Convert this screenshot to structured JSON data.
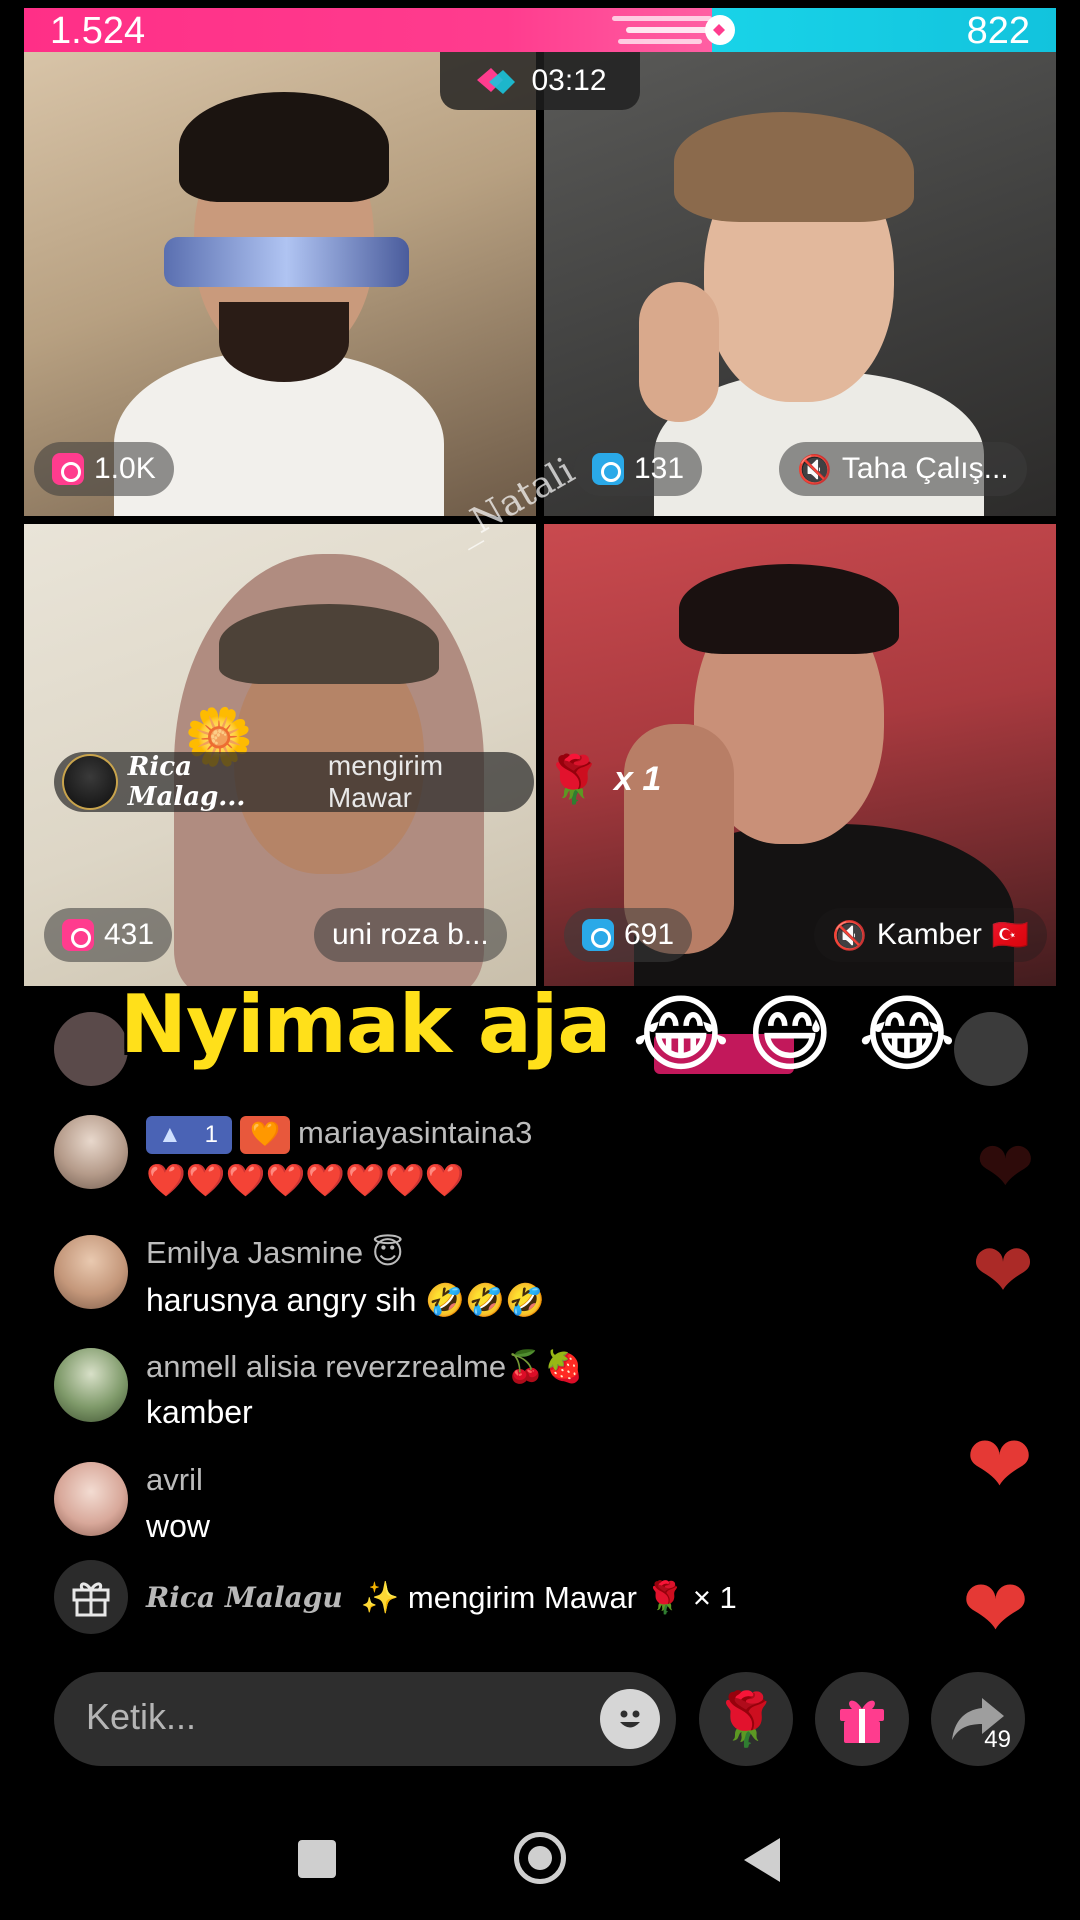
{
  "battle": {
    "score_left": "1.524",
    "score_right": "822",
    "progress_left_fraction": 0.667,
    "colors": {
      "left": "#ff2f87",
      "right": "#19d3e8"
    }
  },
  "timer": {
    "time": "03:12",
    "icon": "battle-icon"
  },
  "hosts": [
    {
      "score": "1.0K",
      "badge": "pink-heart-gift-icon",
      "name": ""
    },
    {
      "score": "131",
      "badge": "blue-heart-gift-icon",
      "name": "Taha Çalış...",
      "muted": true
    },
    {
      "score": "431",
      "badge": "pink-heart-gift-icon",
      "name": "uni roza b..."
    },
    {
      "score": "691",
      "badge": "blue-heart-gift-icon",
      "name": "Kamber",
      "flag": "🇹🇷",
      "muted": true
    }
  ],
  "watermark": "_Natali",
  "gift_banner": {
    "sender": "Rica Malag...",
    "action": "mengirim Mawar",
    "gift_icon": "🌹",
    "count": "x 1"
  },
  "caption": {
    "text": "Nyimak aja",
    "emojis": [
      "😂",
      "😅",
      "😂"
    ]
  },
  "chat": [
    {
      "user": "mariayasintaina3",
      "level": "1",
      "message": "❤️❤️❤️❤️❤️❤️❤️❤️"
    },
    {
      "user": "Emilya Jasmine 😇",
      "message": "harusnya angry sih 🤣🤣🤣"
    },
    {
      "user": "anmell alisia reverzrealme🍒🍓",
      "message": "kamber"
    },
    {
      "user": "avril",
      "message": "wow"
    }
  ],
  "gift_event": {
    "sender": "Rica Malagu",
    "text": "✨ mengirim Mawar 🌹 × 1"
  },
  "input": {
    "placeholder": "Ketik..."
  },
  "actions": {
    "share_count": "49"
  }
}
